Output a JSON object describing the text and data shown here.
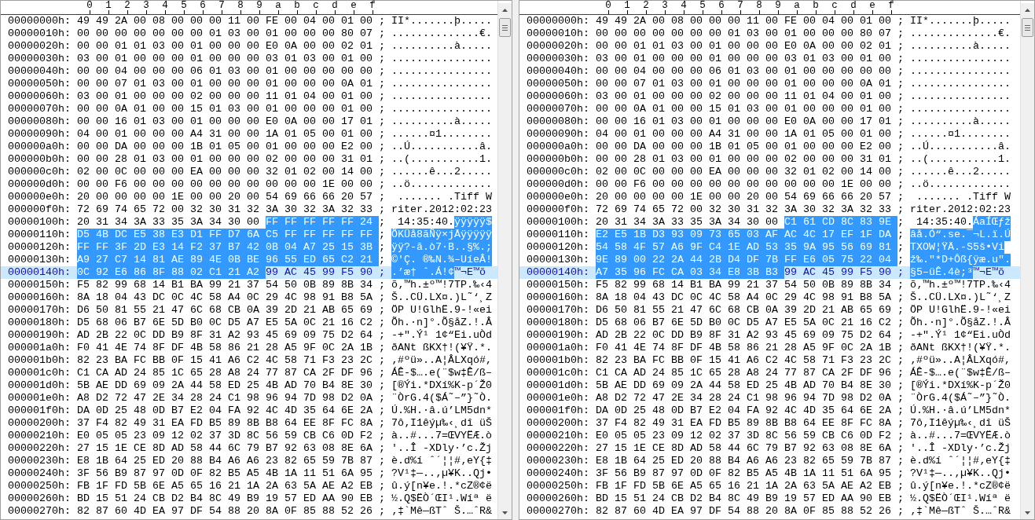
{
  "panes": [
    {
      "columns": [
        "0",
        "1",
        "2",
        "3",
        "4",
        "5",
        "6",
        "7",
        "8",
        "9",
        "a",
        "b",
        "c",
        "d",
        "e",
        "f"
      ],
      "rows": [
        {
          "offset": "00000000h:",
          "hex": [
            {
              "text": "49 49 2A 00 08 00 00 00 11 00 FE 00 04 00 01 00",
              "selected": false
            }
          ],
          "sep": ";",
          "ascii": [
            {
              "text": "II*.......þ.....",
              "selected": false
            }
          ],
          "current": false
        },
        {
          "offset": "00000010h:",
          "hex": [
            {
              "text": "00 00 00 00 00 00 00 01 03 00 01 00 00 00 80 07",
              "selected": false
            }
          ],
          "sep": ";",
          "ascii": [
            {
              "text": "..............€.",
              "selected": false
            }
          ],
          "current": false
        },
        {
          "offset": "00000020h:",
          "hex": [
            {
              "text": "00 00 01 01 03 00 01 00 00 00 E0 0A 00 00 02 01",
              "selected": false
            }
          ],
          "sep": ";",
          "ascii": [
            {
              "text": "..........à.....",
              "selected": false
            }
          ],
          "current": false
        },
        {
          "offset": "00000030h:",
          "hex": [
            {
              "text": "03 00 01 00 00 00 01 00 00 00 03 01 03 00 01 00",
              "selected": false
            }
          ],
          "sep": ";",
          "ascii": [
            {
              "text": "................",
              "selected": false
            }
          ],
          "current": false
        },
        {
          "offset": "00000040h:",
          "hex": [
            {
              "text": "00 00 04 00 00 00 06 01 03 00 01 00 00 00 00 00",
              "selected": false
            }
          ],
          "sep": ";",
          "ascii": [
            {
              "text": "................",
              "selected": false
            }
          ],
          "current": false
        },
        {
          "offset": "00000050h:",
          "hex": [
            {
              "text": "00 00 07 01 03 00 01 00 00 00 01 00 00 00 0A 01",
              "selected": false
            }
          ],
          "sep": ";",
          "ascii": [
            {
              "text": "................",
              "selected": false
            }
          ],
          "current": false
        },
        {
          "offset": "00000060h:",
          "hex": [
            {
              "text": "03 00 01 00 00 00 02 00 00 00 11 01 04 00 01 00",
              "selected": false
            }
          ],
          "sep": ";",
          "ascii": [
            {
              "text": "................",
              "selected": false
            }
          ],
          "current": false
        },
        {
          "offset": "00000070h:",
          "hex": [
            {
              "text": "00 00 0A 01 00 00 15 01 03 00 01 00 00 00 01 00",
              "selected": false
            }
          ],
          "sep": ";",
          "ascii": [
            {
              "text": "................",
              "selected": false
            }
          ],
          "current": false
        },
        {
          "offset": "00000080h:",
          "hex": [
            {
              "text": "00 00 16 01 03 00 01 00 00 00 E0 0A 00 00 17 01",
              "selected": false
            }
          ],
          "sep": ";",
          "ascii": [
            {
              "text": "..........à.....",
              "selected": false
            }
          ],
          "current": false
        },
        {
          "offset": "00000090h:",
          "hex": [
            {
              "text": "04 00 01 00 00 00 A4 31 00 00 1A 01 05 00 01 00",
              "selected": false
            }
          ],
          "sep": ";",
          "ascii": [
            {
              "text": "......¤1........",
              "selected": false
            }
          ],
          "current": false
        },
        {
          "offset": "000000a0h:",
          "hex": [
            {
              "text": "00 00 DA 00 00 00 1B 01 05 00 01 00 00 00 E2 00",
              "selected": false
            }
          ],
          "sep": ";",
          "ascii": [
            {
              "text": "..Ú...........â.",
              "selected": false
            }
          ],
          "current": false
        },
        {
          "offset": "000000b0h:",
          "hex": [
            {
              "text": "00 00 28 01 03 00 01 00 00 00 02 00 00 00 31 01",
              "selected": false
            }
          ],
          "sep": ";",
          "ascii": [
            {
              "text": "..(...........1.",
              "selected": false
            }
          ],
          "current": false
        },
        {
          "offset": "000000c0h:",
          "hex": [
            {
              "text": "02 00 0C 00 00 00 EA 00 00 00 32 01 02 00 14 00",
              "selected": false
            }
          ],
          "sep": ";",
          "ascii": [
            {
              "text": "......ê...2.....",
              "selected": false
            }
          ],
          "current": false
        },
        {
          "offset": "000000d0h:",
          "hex": [
            {
              "text": "00 00 F6 00 00 00 00 00 00 00 00 00 00 1E 00 00",
              "selected": false
            }
          ],
          "sep": ";",
          "ascii": [
            {
              "text": "..ö.............",
              "selected": false
            }
          ],
          "current": false
        },
        {
          "offset": "000000e0h:",
          "hex": [
            {
              "text": "20 00 00 00 00 1E 00 00 20 00 54 69 66 66 20 57",
              "selected": false
            }
          ],
          "sep": ";",
          "ascii": [
            {
              "text": " ....... .Tiff W",
              "selected": false
            }
          ],
          "current": false
        },
        {
          "offset": "000000f0h:",
          "hex": [
            {
              "text": "72 69 74 65 72 00 32 30 31 32 3A 30 32 3A 32 33",
              "selected": false
            }
          ],
          "sep": ";",
          "ascii": [
            {
              "text": "riter.2012:02:23",
              "selected": false
            }
          ],
          "current": false
        },
        {
          "offset": "00000100h:",
          "hex": [
            {
              "text": "20 31 34 3A 33 35 3A 34 30 00",
              "selected": false
            },
            {
              "text": "FF FF FF FF FF 24",
              "selected": true
            }
          ],
          "sep": ";",
          "ascii": [
            {
              "text": " 14:35:40.",
              "selected": false
            },
            {
              "text": "ÿÿÿÿÿ$",
              "selected": true
            }
          ],
          "current": false
        },
        {
          "offset": "00000110h:",
          "hex": [
            {
              "text": "D5 4B DC E5 38 E3 D1 FF D7 6A C5 FF FF FF FF FF",
              "selected": true
            }
          ],
          "sep": ";",
          "ascii": [
            {
              "text": "ÕKÜå8ãÑÿ×jÅÿÿÿÿÿ",
              "selected": true
            }
          ],
          "current": false
        },
        {
          "offset": "00000120h:",
          "hex": [
            {
              "text": "FF FF 3F 2D E3 14 F2 37 B7 42 0B 04 A7 25 15 3B",
              "selected": true
            }
          ],
          "sep": ";",
          "ascii": [
            {
              "text": "ÿÿ?-ã.ò7·B..§%.;",
              "selected": true
            }
          ],
          "current": false
        },
        {
          "offset": "00000130h:",
          "hex": [
            {
              "text": "A9 27 C7 14 81 AE 89 4E 0B BE 96 55 ED 65 C2 21",
              "selected": true
            }
          ],
          "sep": ";",
          "ascii": [
            {
              "text": "©'Ç. ®‰N.¾–UíeÂ!",
              "selected": true
            }
          ],
          "current": false
        },
        {
          "offset": "00000140h:",
          "hex": [
            {
              "text": "0C 92 E6 86 8F 88 02 C1 21 A2",
              "selected": true
            },
            {
              "text": "99 AC 45 99 F5 90",
              "selected": false
            }
          ],
          "sep": ";",
          "ascii": [
            {
              "text": ".’æ† ˆ.Á!¢",
              "selected": true
            },
            {
              "text": "™¬E™õ",
              "selected": false
            }
          ],
          "current": true
        },
        {
          "offset": "00000150h:",
          "hex": [
            {
              "text": "F5 82 99 68 14 B1 BA 99 21 37 54 50 0B 89 8B 34",
              "selected": false
            }
          ],
          "sep": ";",
          "ascii": [
            {
              "text": "õ‚™h.±º™!7TP.‰‹4",
              "selected": false
            }
          ],
          "current": false
        },
        {
          "offset": "00000160h:",
          "hex": [
            {
              "text": "8A 18 04 43 DC 0C 4C 58 A4 0C 29 4C 98 91 B8 5A",
              "selected": false
            }
          ],
          "sep": ";",
          "ascii": [
            {
              "text": "Š..CÜ.LX¤.)L˜‘¸Z",
              "selected": false
            }
          ],
          "current": false
        },
        {
          "offset": "00000170h:",
          "hex": [
            {
              "text": "D6 50 81 55 21 47 6C 68 CB 0A 39 2D 21 AB 65 69",
              "selected": false
            }
          ],
          "sep": ";",
          "ascii": [
            {
              "text": "ÖP U!GlhË.9-!«ei",
              "selected": false
            }
          ],
          "current": false
        },
        {
          "offset": "00000180h:",
          "hex": [
            {
              "text": "D5 68 06 B7 6E 5D B0 0C D5 A7 E5 5A 0C 21 16 C2",
              "selected": false
            }
          ],
          "sep": ";",
          "ascii": [
            {
              "text": "Õh.·n]°.Õ§åZ.!.Â",
              "selected": false
            }
          ],
          "current": false
        },
        {
          "offset": "00000190h:",
          "hex": [
            {
              "text": "AD 2B 22 0C DD B9 8F 31 A2 93 45 69 09 75 D2 64",
              "selected": false
            }
          ],
          "sep": ";",
          "ascii": [
            {
              "text": "-+\".Ý¹ 1¢“Ei.uÒd",
              "selected": false
            }
          ],
          "current": false
        },
        {
          "offset": "000001a0h:",
          "hex": [
            {
              "text": "F0 41 4E 74 8F DF 4B 58 86 21 28 A5 9F 0C 2A 1B",
              "selected": false
            }
          ],
          "sep": ";",
          "ascii": [
            {
              "text": "ðANt ßKX†!(¥Ÿ.*.",
              "selected": false
            }
          ],
          "current": false
        },
        {
          "offset": "000001b0h:",
          "hex": [
            {
              "text": "82 23 BA FC BB 0F 15 41 A6 C2 4C 58 71 F3 23 2C",
              "selected": false
            }
          ],
          "sep": ";",
          "ascii": [
            {
              "text": "‚#ºü»..A¦ÂLXqó#,",
              "selected": false
            }
          ],
          "current": false
        },
        {
          "offset": "000001c0h:",
          "hex": [
            {
              "text": "C1 CA AD 24 85 1C 65 28 A8 24 77 87 CA 2F DF 96",
              "selected": false
            }
          ],
          "sep": ";",
          "ascii": [
            {
              "text": "ÁÊ-$….e(¨$w‡Ê/ß–",
              "selected": false
            }
          ],
          "current": false
        },
        {
          "offset": "000001d0h:",
          "hex": [
            {
              "text": "5B AE DD 69 09 2A 44 58 ED 25 4B AD 70 B4 8E 30",
              "selected": false
            }
          ],
          "sep": ";",
          "ascii": [
            {
              "text": "[®Ýi.*DXí%K-p´Ž0",
              "selected": false
            }
          ],
          "current": false
        },
        {
          "offset": "000001e0h:",
          "hex": [
            {
              "text": "A8 D2 72 47 2E 34 28 24 C1 98 96 94 7D 98 D2 0A",
              "selected": false
            }
          ],
          "sep": ";",
          "ascii": [
            {
              "text": "¨ÒrG.4($Á˜–”}˜Ò.",
              "selected": false
            }
          ],
          "current": false
        },
        {
          "offset": "000001f0h:",
          "hex": [
            {
              "text": "DA 0D 25 48 0D B7 E2 04 FA 92 4C 4D 35 64 6E 2A",
              "selected": false
            }
          ],
          "sep": ";",
          "ascii": [
            {
              "text": "Ú.%H.·â.ú’LM5dn*",
              "selected": false
            }
          ],
          "current": false
        },
        {
          "offset": "00000200h:",
          "hex": [
            {
              "text": "37 F4 82 49 31 EA FD B5 89 8B B8 64 EE 8F FC 8A",
              "selected": false
            }
          ],
          "sep": ";",
          "ascii": [
            {
              "text": "7ô‚I1êýµ‰‹¸dî üŠ",
              "selected": false
            }
          ],
          "current": false
        },
        {
          "offset": "00000210h:",
          "hex": [
            {
              "text": "E0 05 05 23 09 12 02 37 3D 8C 56 59 CB C6 0D F2",
              "selected": false
            }
          ],
          "sep": ";",
          "ascii": [
            {
              "text": "à..#...7=ŒVYËÆ.ò",
              "selected": false
            }
          ],
          "current": false
        },
        {
          "offset": "00000220h:",
          "hex": [
            {
              "text": "27 15 1E CE 8D AD 58 44 6C 79 B7 92 63 08 8E 6A",
              "selected": false
            }
          ],
          "sep": ";",
          "ascii": [
            {
              "text": "'..Î -XDly·’c.Žj",
              "selected": false
            }
          ],
          "current": false
        },
        {
          "offset": "00000230h:",
          "hex": [
            {
              "text": "E8 1B 64 25 ED 20 88 B4 A6 A6 23 82 65 59 7B 87",
              "selected": false
            }
          ],
          "sep": ";",
          "ascii": [
            {
              "text": "è.d%í ˆ´¦¦#‚eY{‡",
              "selected": false
            }
          ],
          "current": false
        },
        {
          "offset": "00000240h:",
          "hex": [
            {
              "text": "3F 56 B9 87 97 0D 0F 82 B5 A5 4B 1A 11 51 6A 95",
              "selected": false
            }
          ],
          "sep": ";",
          "ascii": [
            {
              "text": "?V¹‡—..‚µ¥K..Qj•",
              "selected": false
            }
          ],
          "current": false
        },
        {
          "offset": "00000250h:",
          "hex": [
            {
              "text": "FB 1F FD 5B 6E A5 65 16 21 1A 2A 63 5A AE A2 EB",
              "selected": false
            }
          ],
          "sep": ";",
          "ascii": [
            {
              "text": "û.ý[n¥e.!.*cZ®¢ë",
              "selected": false
            }
          ],
          "current": false
        },
        {
          "offset": "00000260h:",
          "hex": [
            {
              "text": "BD 15 51 24 CB D2 B4 8C 49 B9 19 57 ED AA 90 EB",
              "selected": false
            }
          ],
          "sep": ";",
          "ascii": [
            {
              "text": "½.Q$ËÒ´ŒI¹.Wíª ë",
              "selected": false
            }
          ],
          "current": false
        },
        {
          "offset": "00000270h:",
          "hex": [
            {
              "text": "82 87 60 4D EA 97 DF 54 88 20 8A 0F 85 88 52 26",
              "selected": false
            }
          ],
          "sep": ";",
          "ascii": [
            {
              "text": "‚‡`Mê—ßTˆ Š.…ˆR&",
              "selected": false
            }
          ],
          "current": false
        }
      ]
    },
    {
      "columns": [
        "0",
        "1",
        "2",
        "3",
        "4",
        "5",
        "6",
        "7",
        "8",
        "9",
        "a",
        "b",
        "c",
        "d",
        "e",
        "f"
      ],
      "rows": [
        {
          "offset": "00000000h:",
          "hex": [
            {
              "text": "49 49 2A 00 08 00 00 00 11 00 FE 00 04 00 01 00",
              "selected": false
            }
          ],
          "sep": ";",
          "ascii": [
            {
              "text": "II*.......þ.....",
              "selected": false
            }
          ],
          "current": false
        },
        {
          "offset": "00000010h:",
          "hex": [
            {
              "text": "00 00 00 00 00 00 00 01 03 00 01 00 00 00 80 07",
              "selected": false
            }
          ],
          "sep": ";",
          "ascii": [
            {
              "text": "..............€.",
              "selected": false
            }
          ],
          "current": false
        },
        {
          "offset": "00000020h:",
          "hex": [
            {
              "text": "00 00 01 01 03 00 01 00 00 00 E0 0A 00 00 02 01",
              "selected": false
            }
          ],
          "sep": ";",
          "ascii": [
            {
              "text": "..........à.....",
              "selected": false
            }
          ],
          "current": false
        },
        {
          "offset": "00000030h:",
          "hex": [
            {
              "text": "03 00 01 00 00 00 01 00 00 00 03 01 03 00 01 00",
              "selected": false
            }
          ],
          "sep": ";",
          "ascii": [
            {
              "text": "................",
              "selected": false
            }
          ],
          "current": false
        },
        {
          "offset": "00000040h:",
          "hex": [
            {
              "text": "00 00 04 00 00 00 06 01 03 00 01 00 00 00 00 00",
              "selected": false
            }
          ],
          "sep": ";",
          "ascii": [
            {
              "text": "................",
              "selected": false
            }
          ],
          "current": false
        },
        {
          "offset": "00000050h:",
          "hex": [
            {
              "text": "00 00 07 01 03 00 01 00 00 00 01 00 00 00 0A 01",
              "selected": false
            }
          ],
          "sep": ";",
          "ascii": [
            {
              "text": "................",
              "selected": false
            }
          ],
          "current": false
        },
        {
          "offset": "00000060h:",
          "hex": [
            {
              "text": "03 00 01 00 00 00 02 00 00 00 11 01 04 00 01 00",
              "selected": false
            }
          ],
          "sep": ";",
          "ascii": [
            {
              "text": "................",
              "selected": false
            }
          ],
          "current": false
        },
        {
          "offset": "00000070h:",
          "hex": [
            {
              "text": "00 00 0A 01 00 00 15 01 03 00 01 00 00 00 01 00",
              "selected": false
            }
          ],
          "sep": ";",
          "ascii": [
            {
              "text": "................",
              "selected": false
            }
          ],
          "current": false
        },
        {
          "offset": "00000080h:",
          "hex": [
            {
              "text": "00 00 16 01 03 00 01 00 00 00 E0 0A 00 00 17 01",
              "selected": false
            }
          ],
          "sep": ";",
          "ascii": [
            {
              "text": "..........à.....",
              "selected": false
            }
          ],
          "current": false
        },
        {
          "offset": "00000090h:",
          "hex": [
            {
              "text": "04 00 01 00 00 00 A4 31 00 00 1A 01 05 00 01 00",
              "selected": false
            }
          ],
          "sep": ";",
          "ascii": [
            {
              "text": "......¤1........",
              "selected": false
            }
          ],
          "current": false
        },
        {
          "offset": "000000a0h:",
          "hex": [
            {
              "text": "00 00 DA 00 00 00 1B 01 05 00 01 00 00 00 E2 00",
              "selected": false
            }
          ],
          "sep": ";",
          "ascii": [
            {
              "text": "..Ú...........â.",
              "selected": false
            }
          ],
          "current": false
        },
        {
          "offset": "000000b0h:",
          "hex": [
            {
              "text": "00 00 28 01 03 00 01 00 00 00 02 00 00 00 31 01",
              "selected": false
            }
          ],
          "sep": ";",
          "ascii": [
            {
              "text": "..(...........1.",
              "selected": false
            }
          ],
          "current": false
        },
        {
          "offset": "000000c0h:",
          "hex": [
            {
              "text": "02 00 0C 00 00 00 EA 00 00 00 32 01 02 00 14 00",
              "selected": false
            }
          ],
          "sep": ";",
          "ascii": [
            {
              "text": "......ê...2.....",
              "selected": false
            }
          ],
          "current": false
        },
        {
          "offset": "000000d0h:",
          "hex": [
            {
              "text": "00 00 F6 00 00 00 00 00 00 00 00 00 00 1E 00 00",
              "selected": false
            }
          ],
          "sep": ";",
          "ascii": [
            {
              "text": "..ö.............",
              "selected": false
            }
          ],
          "current": false
        },
        {
          "offset": "000000e0h:",
          "hex": [
            {
              "text": "20 00 00 00 00 1E 00 00 20 00 54 69 66 66 20 57",
              "selected": false
            }
          ],
          "sep": ";",
          "ascii": [
            {
              "text": " ....... .Tiff W",
              "selected": false
            }
          ],
          "current": false
        },
        {
          "offset": "000000f0h:",
          "hex": [
            {
              "text": "72 69 74 65 72 00 32 30 31 32 3A 30 32 3A 32 33",
              "selected": false
            }
          ],
          "sep": ";",
          "ascii": [
            {
              "text": "riter.2012:02:23",
              "selected": false
            }
          ],
          "current": false
        },
        {
          "offset": "00000100h:",
          "hex": [
            {
              "text": "20 31 34 3A 33 35 3A 34 30 00",
              "selected": false
            },
            {
              "text": "C1 61 CD 8C 83 9E",
              "selected": true
            }
          ],
          "sep": ";",
          "ascii": [
            {
              "text": " 14:35:40.",
              "selected": false
            },
            {
              "text": "ÁaÍŒƒž",
              "selected": true
            }
          ],
          "current": false
        },
        {
          "offset": "00000110h:",
          "hex": [
            {
              "text": "E2 E5 1B D3 93 09 73 65 03 AF AC 4C 17 EF 1F DA",
              "selected": true
            }
          ],
          "sep": ";",
          "ascii": [
            {
              "text": "âå.Ó“.se.¯¬L.ï.Ú",
              "selected": true
            }
          ],
          "current": false
        },
        {
          "offset": "00000120h:",
          "hex": [
            {
              "text": "54 58 4F 57 A6 9F C4 1E AD 53 35 9A 95 56 69 81",
              "selected": true
            }
          ],
          "sep": ";",
          "ascii": [
            {
              "text": "TXOW¦ŸÄ.-S5š•Vi",
              "selected": true
            }
          ],
          "current": false
        },
        {
          "offset": "00000130h:",
          "hex": [
            {
              "text": "9E 89 00 22 2A 44 2B D4 DF 7B FF E6 05 75 22 04",
              "selected": true
            }
          ],
          "sep": ";",
          "ascii": [
            {
              "text": "ž‰.\"*D+Ôß{ÿæ.u\".",
              "selected": true
            }
          ],
          "current": false
        },
        {
          "offset": "00000140h:",
          "hex": [
            {
              "text": "A7 35 96 FC CA 03 34 E8 3B B3",
              "selected": true
            },
            {
              "text": "99 AC 45 99 F5 90",
              "selected": false
            }
          ],
          "sep": ";",
          "ascii": [
            {
              "text": "§5–üÊ.4è;³",
              "selected": true
            },
            {
              "text": "™¬E™õ",
              "selected": false
            }
          ],
          "current": true
        },
        {
          "offset": "00000150h:",
          "hex": [
            {
              "text": "F5 82 99 68 14 B1 BA 99 21 37 54 50 0B 89 8B 34",
              "selected": false
            }
          ],
          "sep": ";",
          "ascii": [
            {
              "text": "õ‚™h.±º™!7TP.‰‹4",
              "selected": false
            }
          ],
          "current": false
        },
        {
          "offset": "00000160h:",
          "hex": [
            {
              "text": "8A 18 04 43 DC 0C 4C 58 A4 0C 29 4C 98 91 B8 5A",
              "selected": false
            }
          ],
          "sep": ";",
          "ascii": [
            {
              "text": "Š..CÜ.LX¤.)L˜‘¸Z",
              "selected": false
            }
          ],
          "current": false
        },
        {
          "offset": "00000170h:",
          "hex": [
            {
              "text": "D6 50 81 55 21 47 6C 68 CB 0A 39 2D 21 AB 65 69",
              "selected": false
            }
          ],
          "sep": ";",
          "ascii": [
            {
              "text": "ÖP U!GlhË.9-!«ei",
              "selected": false
            }
          ],
          "current": false
        },
        {
          "offset": "00000180h:",
          "hex": [
            {
              "text": "D5 68 06 B7 6E 5D B0 0C D5 A7 E5 5A 0C 21 16 C2",
              "selected": false
            }
          ],
          "sep": ";",
          "ascii": [
            {
              "text": "Õh.·n]°.Õ§åZ.!.Â",
              "selected": false
            }
          ],
          "current": false
        },
        {
          "offset": "00000190h:",
          "hex": [
            {
              "text": "AD 2B 22 0C DD B9 8F 31 A2 93 45 69 09 75 D2 64",
              "selected": false
            }
          ],
          "sep": ";",
          "ascii": [
            {
              "text": "-+\".Ý¹ 1¢“Ei.uÒd",
              "selected": false
            }
          ],
          "current": false
        },
        {
          "offset": "000001a0h:",
          "hex": [
            {
              "text": "F0 41 4E 74 8F DF 4B 58 86 21 28 A5 9F 0C 2A 1B",
              "selected": false
            }
          ],
          "sep": ";",
          "ascii": [
            {
              "text": "ðANt ßKX†!(¥Ÿ.*.",
              "selected": false
            }
          ],
          "current": false
        },
        {
          "offset": "000001b0h:",
          "hex": [
            {
              "text": "82 23 BA FC BB 0F 15 41 A6 C2 4C 58 71 F3 23 2C",
              "selected": false
            }
          ],
          "sep": ";",
          "ascii": [
            {
              "text": "‚#ºü»..A¦ÂLXqó#,",
              "selected": false
            }
          ],
          "current": false
        },
        {
          "offset": "000001c0h:",
          "hex": [
            {
              "text": "C1 CA AD 24 85 1C 65 28 A8 24 77 87 CA 2F DF 96",
              "selected": false
            }
          ],
          "sep": ";",
          "ascii": [
            {
              "text": "ÁÊ-$….e(¨$w‡Ê/ß–",
              "selected": false
            }
          ],
          "current": false
        },
        {
          "offset": "000001d0h:",
          "hex": [
            {
              "text": "5B AE DD 69 09 2A 44 58 ED 25 4B AD 70 B4 8E 30",
              "selected": false
            }
          ],
          "sep": ";",
          "ascii": [
            {
              "text": "[®Ýi.*DXí%K-p´Ž0",
              "selected": false
            }
          ],
          "current": false
        },
        {
          "offset": "000001e0h:",
          "hex": [
            {
              "text": "A8 D2 72 47 2E 34 28 24 C1 98 96 94 7D 98 D2 0A",
              "selected": false
            }
          ],
          "sep": ";",
          "ascii": [
            {
              "text": "¨ÒrG.4($Á˜–”}˜Ò.",
              "selected": false
            }
          ],
          "current": false
        },
        {
          "offset": "000001f0h:",
          "hex": [
            {
              "text": "DA 0D 25 48 0D B7 E2 04 FA 92 4C 4D 35 64 6E 2A",
              "selected": false
            }
          ],
          "sep": ";",
          "ascii": [
            {
              "text": "Ú.%H.·â.ú’LM5dn*",
              "selected": false
            }
          ],
          "current": false
        },
        {
          "offset": "00000200h:",
          "hex": [
            {
              "text": "37 F4 82 49 31 EA FD B5 89 8B B8 64 EE 8F FC 8A",
              "selected": false
            }
          ],
          "sep": ";",
          "ascii": [
            {
              "text": "7ô‚I1êýµ‰‹¸dî üŠ",
              "selected": false
            }
          ],
          "current": false
        },
        {
          "offset": "00000210h:",
          "hex": [
            {
              "text": "E0 05 05 23 09 12 02 37 3D 8C 56 59 CB C6 0D F2",
              "selected": false
            }
          ],
          "sep": ";",
          "ascii": [
            {
              "text": "à..#...7=ŒVYËÆ.ò",
              "selected": false
            }
          ],
          "current": false
        },
        {
          "offset": "00000220h:",
          "hex": [
            {
              "text": "27 15 1E CE 8D AD 58 44 6C 79 B7 92 63 08 8E 6A",
              "selected": false
            }
          ],
          "sep": ";",
          "ascii": [
            {
              "text": "'..Î -XDly·’c.Žj",
              "selected": false
            }
          ],
          "current": false
        },
        {
          "offset": "00000230h:",
          "hex": [
            {
              "text": "E8 1B 64 25 ED 20 88 B4 A6 A6 23 82 65 59 7B 87",
              "selected": false
            }
          ],
          "sep": ";",
          "ascii": [
            {
              "text": "è.d%í ˆ´¦¦#‚eY{‡",
              "selected": false
            }
          ],
          "current": false
        },
        {
          "offset": "00000240h:",
          "hex": [
            {
              "text": "3F 56 B9 87 97 0D 0F 82 B5 A5 4B 1A 11 51 6A 95",
              "selected": false
            }
          ],
          "sep": ";",
          "ascii": [
            {
              "text": "?V¹‡—..‚µ¥K..Qj•",
              "selected": false
            }
          ],
          "current": false
        },
        {
          "offset": "00000250h:",
          "hex": [
            {
              "text": "FB 1F FD 5B 6E A5 65 16 21 1A 2A 63 5A AE A2 EB",
              "selected": false
            }
          ],
          "sep": ";",
          "ascii": [
            {
              "text": "û.ý[n¥e.!.*cZ®¢ë",
              "selected": false
            }
          ],
          "current": false
        },
        {
          "offset": "00000260h:",
          "hex": [
            {
              "text": "BD 15 51 24 CB D2 B4 8C 49 B9 19 57 ED AA 90 EB",
              "selected": false
            }
          ],
          "sep": ";",
          "ascii": [
            {
              "text": "½.Q$ËÒ´ŒI¹.Wíª ë",
              "selected": false
            }
          ],
          "current": false
        },
        {
          "offset": "00000270h:",
          "hex": [
            {
              "text": "82 87 60 4D EA 97 DF 54 88 20 8A 0F 85 88 52 26",
              "selected": false
            }
          ],
          "sep": ";",
          "ascii": [
            {
              "text": "‚‡`Mê—ßTˆ Š.…ˆR&",
              "selected": false
            }
          ],
          "current": false
        }
      ]
    }
  ]
}
